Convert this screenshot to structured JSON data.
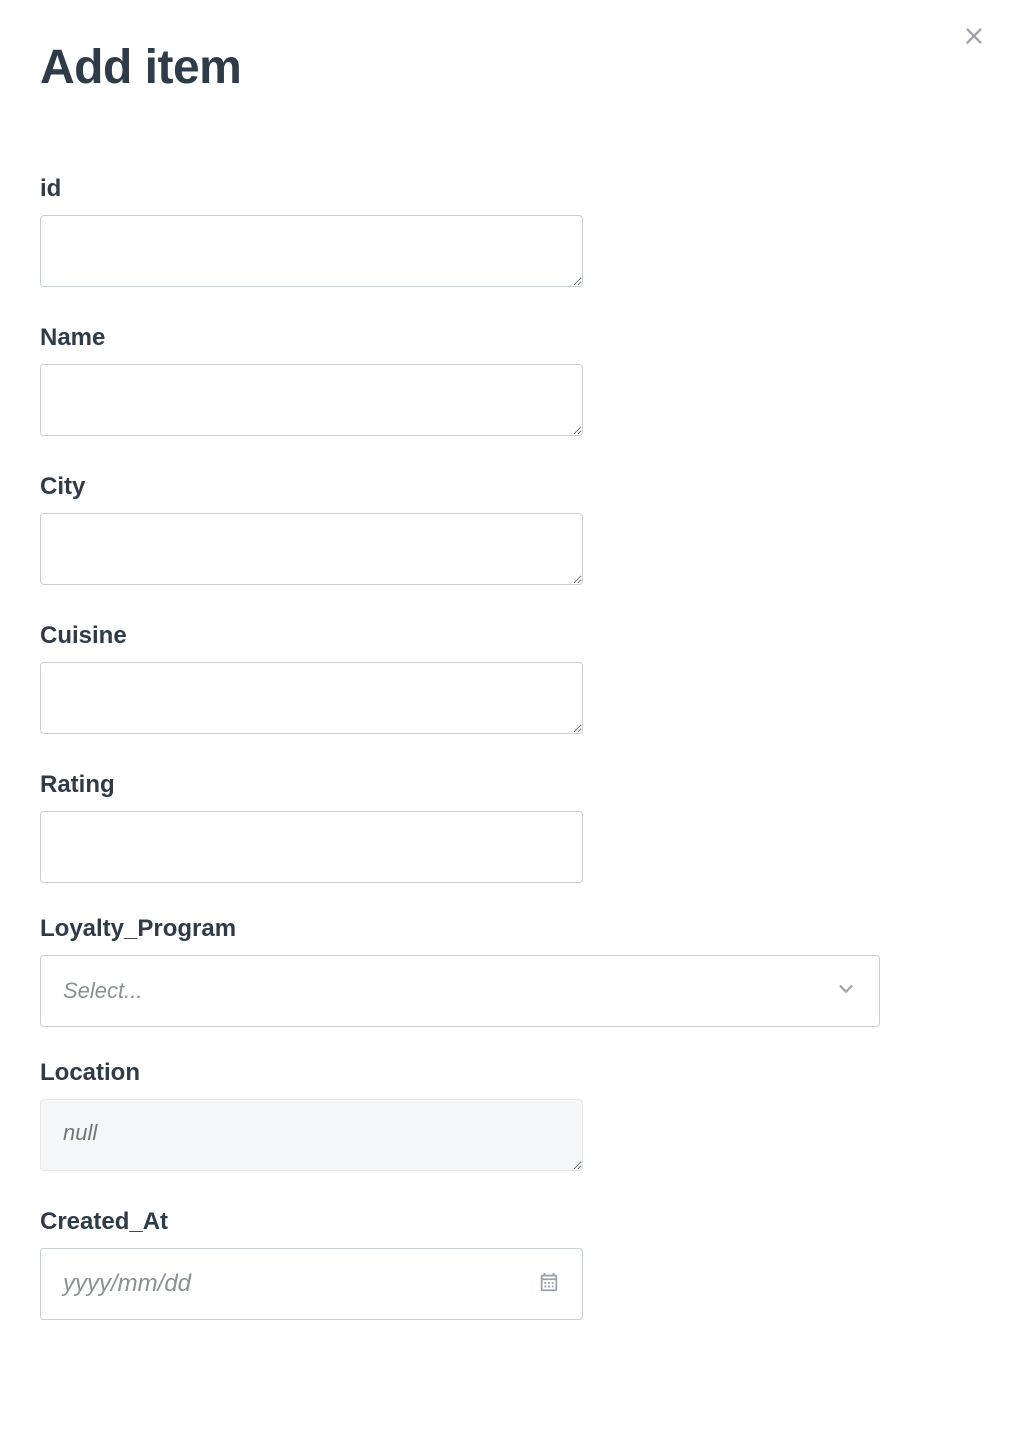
{
  "modal": {
    "title": "Add item",
    "close_icon": "close"
  },
  "form": {
    "fields": {
      "id": {
        "label": "id",
        "value": ""
      },
      "name": {
        "label": "Name",
        "value": ""
      },
      "city": {
        "label": "City",
        "value": ""
      },
      "cuisine": {
        "label": "Cuisine",
        "value": ""
      },
      "rating": {
        "label": "Rating",
        "value": ""
      },
      "loyalty_program": {
        "label": "Loyalty_Program",
        "placeholder": "Select...",
        "value": ""
      },
      "location": {
        "label": "Location",
        "placeholder": "null",
        "value": ""
      },
      "created_at": {
        "label": "Created_At",
        "placeholder": "yyyy/mm/dd",
        "value": ""
      }
    }
  }
}
